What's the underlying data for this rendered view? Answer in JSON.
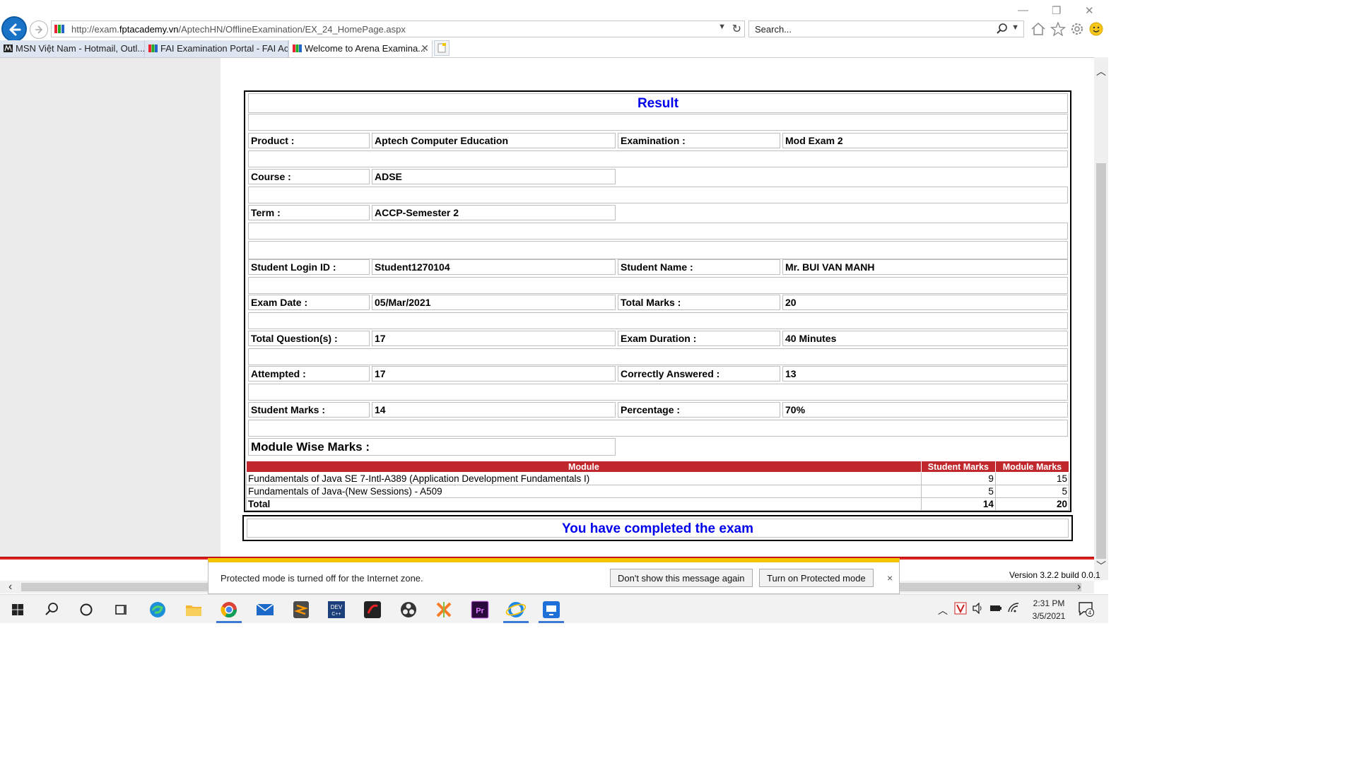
{
  "browser": {
    "url_prefix": "http://exam.",
    "url_domain": "fptacademy.vn",
    "url_path": "/AptechHN/OfflineExamination/EX_24_HomePage.aspx",
    "search_placeholder": "Search...",
    "tabs": [
      {
        "label": "MSN Việt Nam - Hotmail, Outl...",
        "active": false
      },
      {
        "label": "FAI Examination Portal - FAI Ac...",
        "active": false
      },
      {
        "label": "Welcome to Arena Examina...",
        "active": true
      }
    ]
  },
  "result": {
    "title": "Result",
    "fields": {
      "product_label": "Product :",
      "product": "Aptech Computer Education",
      "exam_label": "Examination :",
      "exam": "Mod Exam 2",
      "course_label": "Course :",
      "course": "ADSE",
      "term_label": "Term :",
      "term": "ACCP-Semester 2",
      "login_label": "Student Login ID :",
      "login": "Student1270104",
      "name_label": "Student Name :",
      "name": "Mr. BUI VAN MANH",
      "date_label": "Exam Date :",
      "date": "05/Mar/2021",
      "total_marks_label": "Total Marks :",
      "total_marks": "20",
      "questions_label": "Total Question(s) :",
      "questions": "17",
      "duration_label": "Exam Duration :",
      "duration": "40 Minutes",
      "attempted_label": "Attempted :",
      "attempted": "17",
      "correct_label": "Correctly Answered :",
      "correct": "13",
      "student_marks_label": "Student Marks :",
      "student_marks": "14",
      "percentage_label": "Percentage :",
      "percentage": "70%"
    },
    "module_wise_label": "Module Wise Marks :",
    "module_table": {
      "headers": [
        "Module",
        "Student Marks",
        "Module Marks"
      ],
      "rows": [
        [
          "Fundamentals of Java SE 7-Intl-A389 (Application Development Fundamentals I)",
          "9",
          "15"
        ],
        [
          "Fundamentals of Java-(New Sessions) - A509",
          "5",
          "5"
        ]
      ],
      "total": [
        "Total",
        "14",
        "20"
      ]
    },
    "completed": "You have completed the exam"
  },
  "version": "Version 3.2.2 build 0.0.1",
  "notification": {
    "text": "Protected mode is turned off for the Internet zone.",
    "dont_show": "Don't show this message again",
    "turn_on": "Turn on Protected mode",
    "close": "×"
  },
  "taskbar": {
    "time": "2:31 PM",
    "date": "3/5/2021",
    "notif_count": "4"
  },
  "colors": {
    "accent_blue": "#0000ee",
    "header_red": "#c0282d"
  }
}
